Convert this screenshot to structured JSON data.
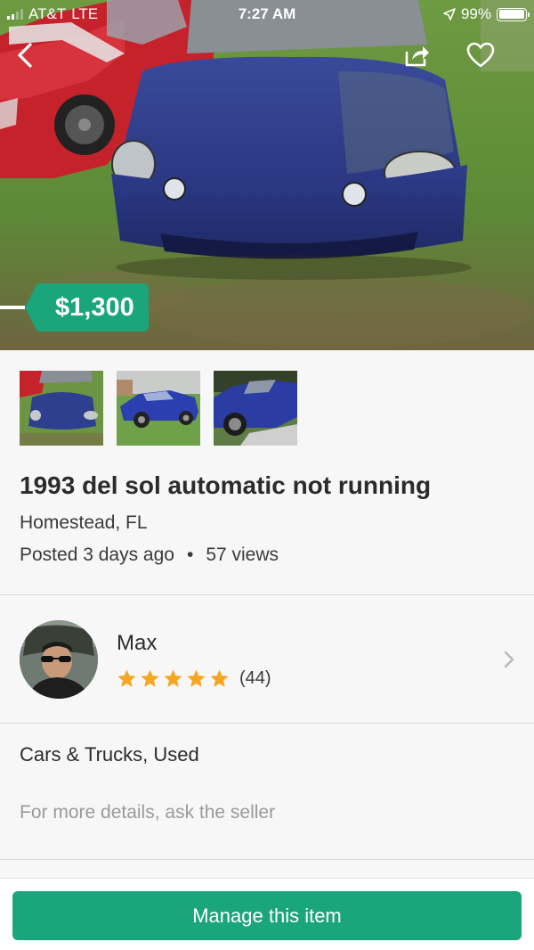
{
  "status_bar": {
    "carrier": "AT&T",
    "network": "LTE",
    "time": "7:27 AM",
    "battery": "99%",
    "battery_level": 0.99
  },
  "nav": {
    "back_icon": "chevron-left-icon",
    "share_icon": "share-icon",
    "favorite_icon": "heart-icon"
  },
  "listing": {
    "price": "$1,300",
    "title": "1993 del sol automatic not running",
    "location": "Homestead, FL",
    "posted": "Posted 3 days ago",
    "separator": "•",
    "views": "57 views",
    "photo_count": 3,
    "category": "Cars & Trucks, Used",
    "details_note": "For more details, ask the seller"
  },
  "seller": {
    "name": "Max",
    "rating": 5,
    "rating_count": "(44)"
  },
  "actions": {
    "manage_label": "Manage this item"
  },
  "colors": {
    "brand_green": "#1aa57a",
    "star_orange": "#f5a623",
    "car_blue": "#2f3f8f"
  }
}
